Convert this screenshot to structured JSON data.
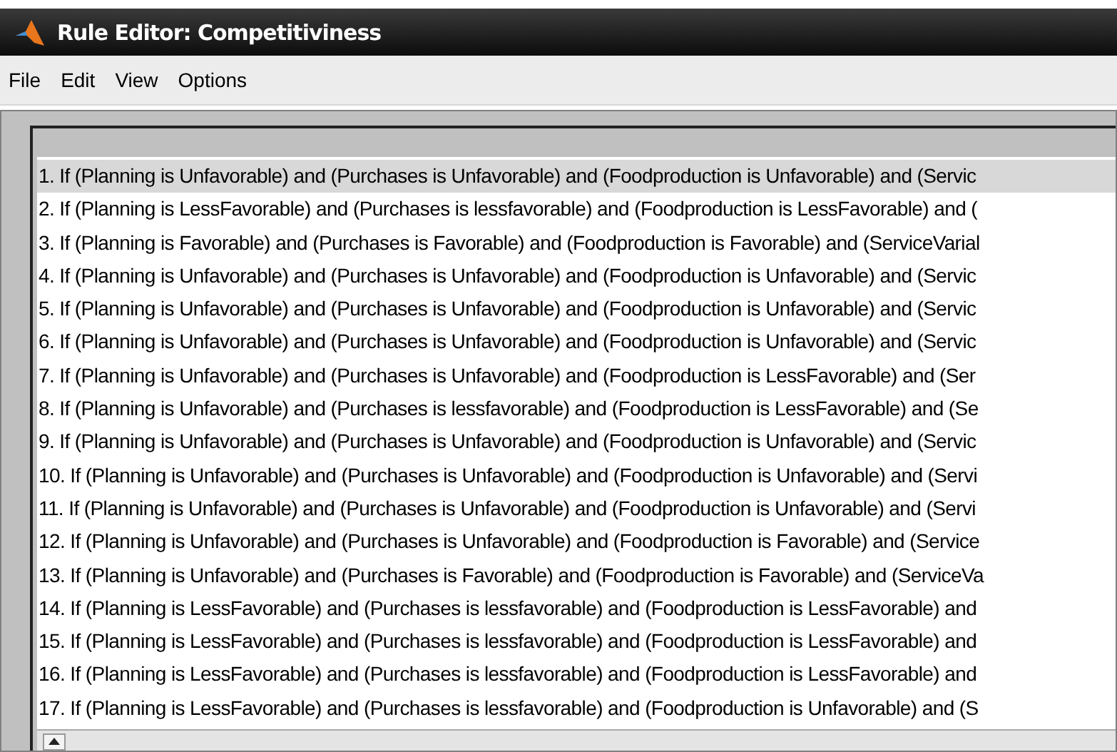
{
  "window": {
    "title": "Rule Editor: Competitiviness"
  },
  "menu": [
    "File",
    "Edit",
    "View",
    "Options"
  ],
  "rules": [
    {
      "text": "1. If (Planning is Unfavorable) and (Purchases is Unfavorable) and (Foodproduction is Unfavorable) and (Servic",
      "selected": true
    },
    {
      "text": "2. If (Planning is LessFavorable) and (Purchases is lessfavorable) and (Foodproduction is LessFavorable) and (",
      "selected": false
    },
    {
      "text": "3. If (Planning is Favorable) and (Purchases is Favorable) and (Foodproduction is Favorable) and (ServiceVarial",
      "selected": false
    },
    {
      "text": "4. If (Planning is Unfavorable) and (Purchases is Unfavorable) and (Foodproduction is Unfavorable) and (Servic",
      "selected": false
    },
    {
      "text": "5. If (Planning is Unfavorable) and (Purchases is Unfavorable) and (Foodproduction is Unfavorable) and (Servic",
      "selected": false
    },
    {
      "text": "6. If (Planning is Unfavorable) and (Purchases is Unfavorable) and (Foodproduction is Unfavorable) and (Servic",
      "selected": false
    },
    {
      "text": "7. If (Planning is Unfavorable) and (Purchases is Unfavorable) and (Foodproduction is LessFavorable) and (Ser",
      "selected": false
    },
    {
      "text": "8. If (Planning is Unfavorable) and (Purchases is lessfavorable) and (Foodproduction is LessFavorable) and (Se",
      "selected": false
    },
    {
      "text": "9. If (Planning is Unfavorable) and (Purchases is Unfavorable) and (Foodproduction is Unfavorable) and (Servic",
      "selected": false
    },
    {
      "text": "10. If (Planning is Unfavorable) and (Purchases is Unfavorable) and (Foodproduction is Unfavorable) and (Servi",
      "selected": false
    },
    {
      "text": "11. If (Planning is Unfavorable) and (Purchases is Unfavorable) and (Foodproduction is Unfavorable) and (Servi",
      "selected": false
    },
    {
      "text": "12. If (Planning is Unfavorable) and (Purchases is Unfavorable) and (Foodproduction is Favorable) and (Service",
      "selected": false
    },
    {
      "text": "13. If (Planning is Unfavorable) and (Purchases is Favorable) and (Foodproduction is Favorable) and (ServiceVa",
      "selected": false
    },
    {
      "text": "14. If (Planning is LessFavorable) and (Purchases is lessfavorable) and (Foodproduction is LessFavorable) and",
      "selected": false
    },
    {
      "text": "15. If (Planning is LessFavorable) and (Purchases is lessfavorable) and (Foodproduction is LessFavorable) and",
      "selected": false
    },
    {
      "text": "16. If (Planning is LessFavorable) and (Purchases is lessfavorable) and (Foodproduction is LessFavorable) and",
      "selected": false
    },
    {
      "text": "17. If (Planning is LessFavorable) and (Purchases is lessfavorable) and (Foodproduction is Unfavorable) and (S",
      "selected": false
    }
  ]
}
